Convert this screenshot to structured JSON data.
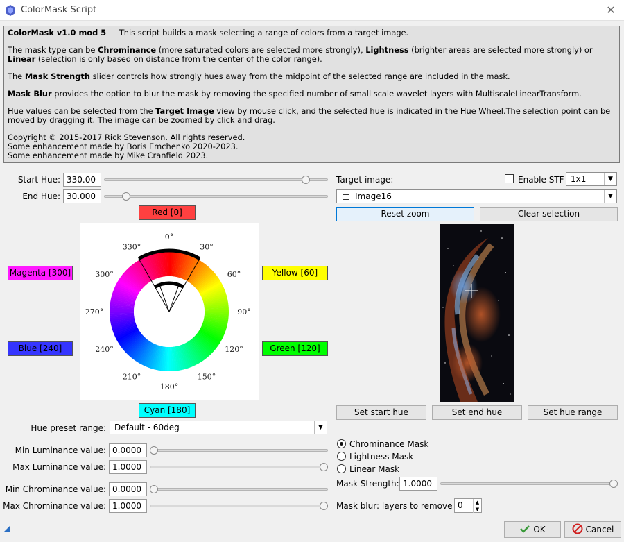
{
  "window": {
    "title": "ColorMask Script",
    "icon": "pixinsight-icon"
  },
  "info": {
    "heading": "ColorMask v1.0 mod 5",
    "intro": " — This script builds a mask selecting a range of colors from a target image.",
    "p2_a": "The mask type can be ",
    "p2_b": "Chrominance",
    "p2_c": " (more saturated colors are selected more strongly), ",
    "p2_d": "Lightness",
    "p2_e": " (brighter areas are selected more strongly) or ",
    "p2_f": "Linear",
    "p2_g": " (selection is only based on distance from the center of the color range).",
    "p3_a": "The ",
    "p3_b": "Mask Strength",
    "p3_c": " slider controls how strongly hues away from the midpoint of the selected range are included in the mask.",
    "p4_a": "Mask Blur",
    "p4_b": " provides the option to blur the mask by removing the specified number of small scale wavelet layers with MultiscaleLinearTransform.",
    "p5_a": "Hue values can be selected from the ",
    "p5_b": "Target Image",
    "p5_c": " view by mouse click, and the selected hue is indicated in the Hue Wheel.The selection point can be moved by dragging it. The image can be zoomed by click and drag.",
    "copy1": "Copyright © 2015-2017 Rick Stevenson. All rights reserved.",
    "copy2": "Some enhancement made by Boris Emchenko 2020-2023.",
    "copy3": "Some enhancement made by Mike Cranfield 2023."
  },
  "hue": {
    "start_label": "Start Hue:",
    "start_value": "330.00",
    "start_fraction": 0.917,
    "end_label": "End Hue:",
    "end_value": "30.000",
    "end_fraction": 0.083
  },
  "colors": {
    "red": {
      "label": "Red [0]",
      "bg": "#ff4040"
    },
    "magenta": {
      "label": "Magenta [300]",
      "bg": "#ff1aff"
    },
    "yellow": {
      "label": "Yellow [60]",
      "bg": "#ffff00"
    },
    "blue": {
      "label": "Blue [240]",
      "bg": "#3535ff"
    },
    "green": {
      "label": "Green [120]",
      "bg": "#00ff00"
    },
    "cyan": {
      "label": "Cyan [180]",
      "bg": "#00ffff"
    }
  },
  "wheel": {
    "degrees": [
      "0°",
      "30°",
      "60°",
      "90°",
      "120°",
      "150°",
      "180°",
      "210°",
      "240°",
      "270°",
      "300°",
      "330°"
    ]
  },
  "preset": {
    "label": "Hue preset range:",
    "value": "Default - 60deg"
  },
  "luminance": {
    "min_label": "Min Luminance value:",
    "min_value": "0.0000",
    "min_fraction": 0,
    "max_label": "Max Luminance value:",
    "max_value": "1.0000",
    "max_fraction": 1
  },
  "chrominance": {
    "min_label": "Min Chrominance value:",
    "min_value": "0.0000",
    "min_fraction": 0,
    "max_label": "Max Chrominance value:",
    "max_value": "1.0000",
    "max_fraction": 1
  },
  "target": {
    "label": "Target image:",
    "image": "Image16",
    "stf_label": "Enable STF",
    "stf_checked": false,
    "stf_mode": "1x1",
    "reset_zoom": "Reset zoom",
    "clear_selection": "Clear selection"
  },
  "hue_buttons": {
    "start": "Set start hue",
    "end": "Set end hue",
    "range": "Set hue range"
  },
  "mask": {
    "options": [
      "Chrominance Mask",
      "Lightness Mask",
      "Linear Mask"
    ],
    "selected": 0,
    "strength_label": "Mask Strength:",
    "strength_value": "1.0000",
    "strength_fraction": 1,
    "blur_label": "Mask blur: layers to remove",
    "blur_value": "0"
  },
  "footer": {
    "ok": "OK",
    "cancel": "Cancel"
  }
}
